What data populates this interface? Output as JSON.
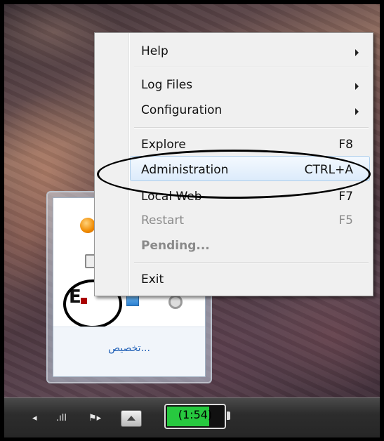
{
  "context_menu": {
    "items": [
      {
        "label": "Help",
        "shortcut": "",
        "submenu": true,
        "state": "normal"
      },
      {
        "label": "Log Files",
        "shortcut": "",
        "submenu": true,
        "state": "normal"
      },
      {
        "label": "Configuration",
        "shortcut": "",
        "submenu": true,
        "state": "normal"
      },
      {
        "label": "Explore",
        "shortcut": "F8",
        "submenu": false,
        "state": "normal"
      },
      {
        "label": "Administration",
        "shortcut": "CTRL+A",
        "submenu": false,
        "state": "highlighted"
      },
      {
        "label": "Local Web",
        "shortcut": "F7",
        "submenu": false,
        "state": "normal"
      },
      {
        "label": "Restart",
        "shortcut": "F5",
        "submenu": false,
        "state": "disabled"
      },
      {
        "label": "Pending...",
        "shortcut": "",
        "submenu": false,
        "state": "disabled-bold"
      },
      {
        "label": "Exit",
        "shortcut": "",
        "submenu": false,
        "state": "normal"
      }
    ]
  },
  "tray_popup": {
    "customize_link": "تخصيص...",
    "icons": [
      "orange-orb-icon",
      "usb-device-icon",
      "e-app-icon",
      "network-icon",
      "disc-icon"
    ]
  },
  "taskbar": {
    "battery_text": "(1:54)",
    "battery_level": 0.75,
    "icons": [
      "speaker-icon",
      "signal-icon",
      "flag-icon",
      "show-hidden-icons-button"
    ]
  },
  "colors": {
    "menu_bg": "#f0f0f0",
    "highlight": "#dcebfb",
    "link": "#1f5fb6",
    "battery": "#27c93f"
  }
}
